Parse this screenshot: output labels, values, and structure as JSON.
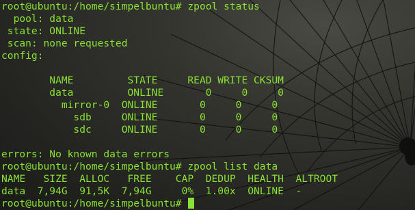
{
  "terminal": {
    "colors": {
      "text": "#8ae234",
      "cursor": "#8ae234"
    },
    "lines": [
      "root@ubuntu:/home/simpelbuntu# zpool status",
      "  pool: data",
      " state: ONLINE",
      " scan: none requested",
      "config:",
      "",
      "        NAME         STATE     READ WRITE CKSUM",
      "        data         ONLINE       0     0     0",
      "          mirror-0  ONLINE       0     0     0",
      "            sdb     ONLINE       0     0     0",
      "            sdc     ONLINE       0     0     0",
      "",
      "errors: No known data errors",
      "root@ubuntu:/home/simpelbuntu# zpool list data",
      "NAME   SIZE  ALLOC   FREE    CAP  DEDUP  HEALTH  ALTROOT",
      "data  7,94G  91,5K  7,94G     0%  1.00x  ONLINE  -",
      "root@ubuntu:/home/simpelbuntu# "
    ]
  }
}
